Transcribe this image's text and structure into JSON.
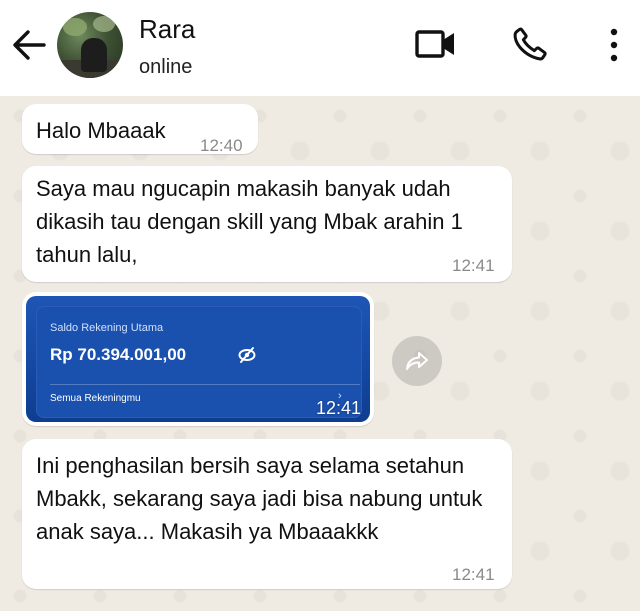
{
  "header": {
    "contact_name": "Rara",
    "status": "online",
    "icons": [
      "back-arrow-icon",
      "video-call-icon",
      "phone-call-icon",
      "more-vertical-icon"
    ]
  },
  "messages": [
    {
      "text": "Halo Mbaaak",
      "time": "12:40"
    },
    {
      "text": "Saya mau ngucapin makasih banyak udah dikasih tau dengan skill yang Mbak arahin 1 tahun lalu,",
      "time": "12:41"
    },
    {
      "type": "image",
      "time": "12:41",
      "card": {
        "label": "Saldo Rekening Utama",
        "balance": "Rp 70.394.001,00",
        "link": "Semua Rekeningmu"
      }
    },
    {
      "text": "Ini penghasilan bersih saya selama setahun Mbakk, sekarang saya jadi bisa nabung untuk anak saya... Makasih ya Mbaaakkk",
      "time": "12:41"
    }
  ],
  "colors": {
    "chat_background": "#efeae2",
    "bubble": "#ffffff",
    "card_blue": "#1a50ae",
    "timestamp": "#8a8a8a"
  }
}
